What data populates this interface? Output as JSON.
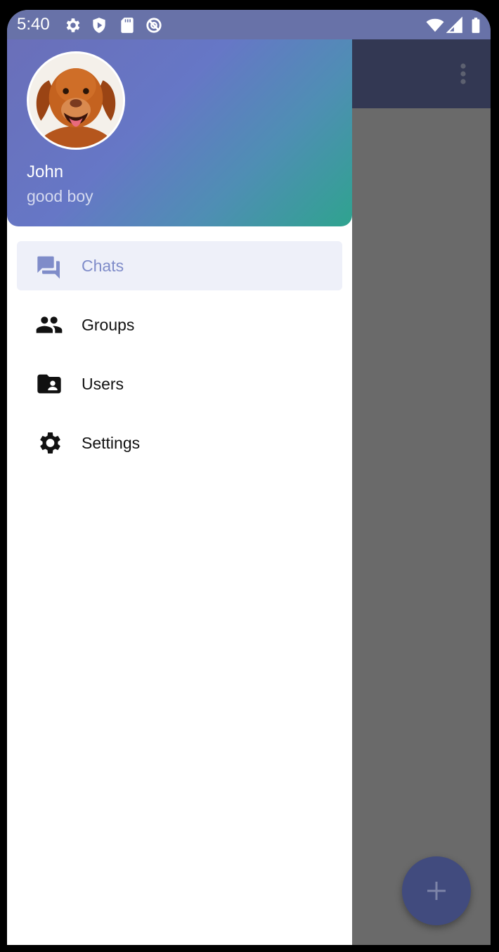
{
  "status_bar": {
    "time": "5:40"
  },
  "drawer": {
    "user": {
      "name": "John",
      "status": "good boy"
    },
    "items": [
      {
        "label": "Chats",
        "icon": "chats-icon",
        "active": true
      },
      {
        "label": "Groups",
        "icon": "groups-icon",
        "active": false
      },
      {
        "label": "Users",
        "icon": "users-folder-icon",
        "active": false
      },
      {
        "label": "Settings",
        "icon": "gear-icon",
        "active": false
      }
    ]
  },
  "colors": {
    "status_bar": "#6872a8",
    "toolbar": "#333853",
    "accent": "#6677c6",
    "active_item_bg": "#eef0f9",
    "active_item_text": "#7f8cc9",
    "fab": "#414b7e"
  }
}
